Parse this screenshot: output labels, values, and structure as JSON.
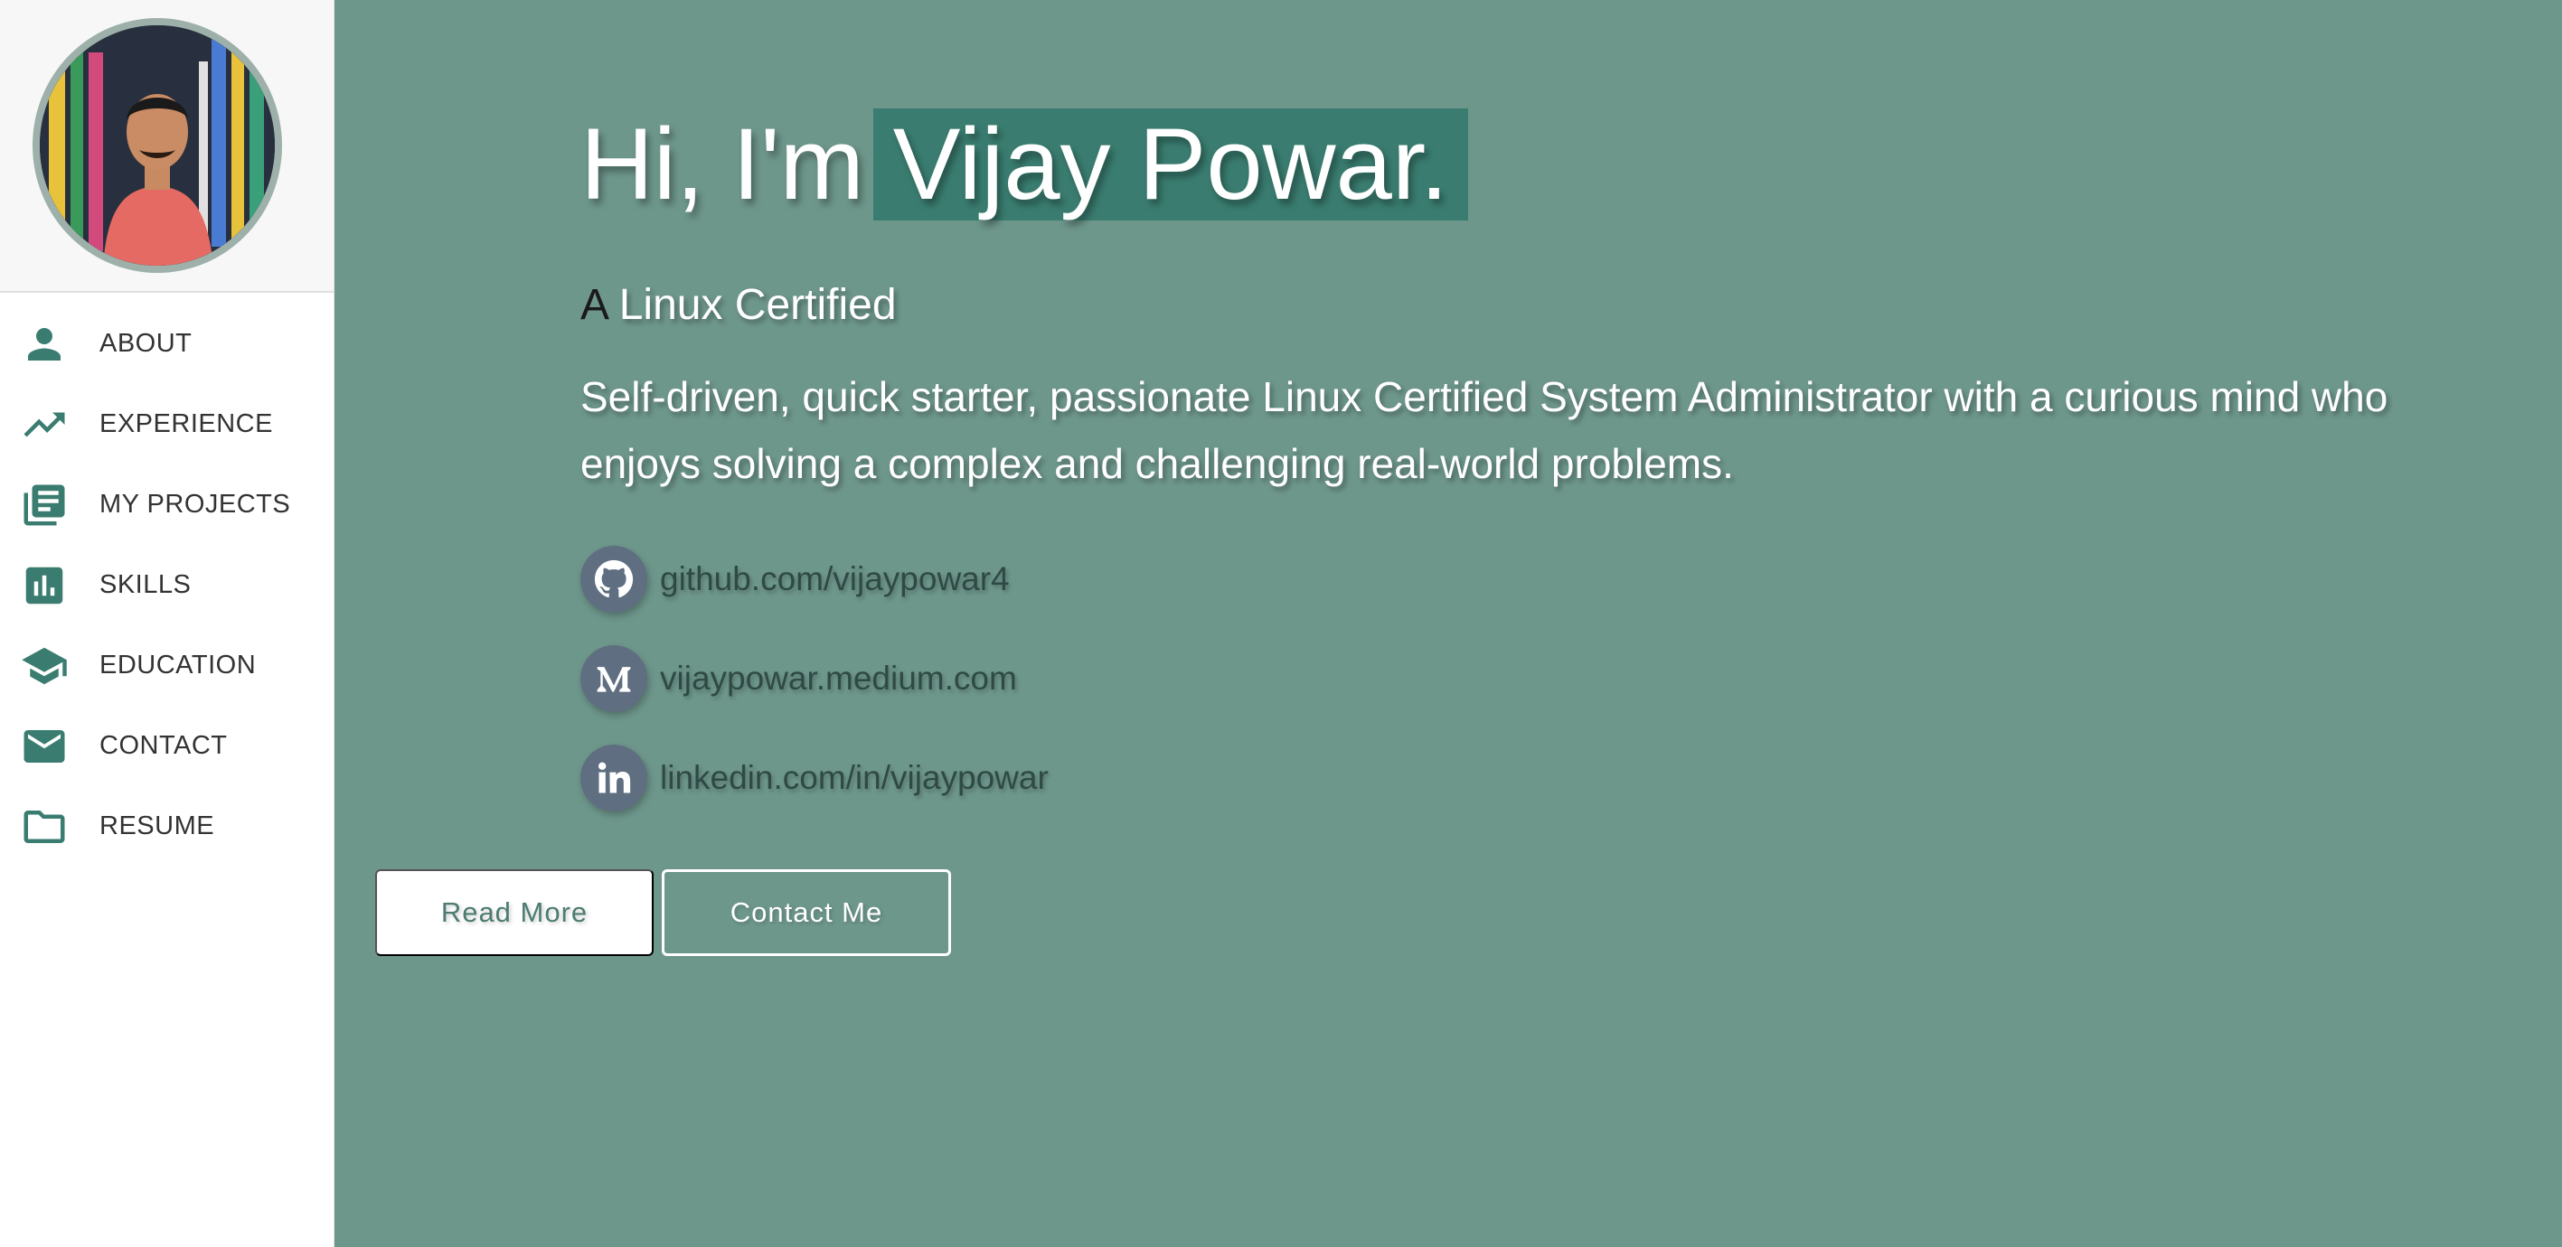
{
  "sidebar": {
    "profile": {
      "avatar_alt": "profile photo"
    },
    "items": [
      {
        "label": "ABOUT",
        "icon": "person-icon"
      },
      {
        "label": "EXPERIENCE",
        "icon": "trending-up-icon"
      },
      {
        "label": "MY PROJECTS",
        "icon": "library-books-icon"
      },
      {
        "label": "SKILLS",
        "icon": "bar-chart-icon"
      },
      {
        "label": "EDUCATION",
        "icon": "graduation-cap-icon"
      },
      {
        "label": "CONTACT",
        "icon": "mail-icon"
      },
      {
        "label": "RESUME",
        "icon": "folder-icon"
      }
    ]
  },
  "hero": {
    "greeting_prefix": "Hi, I'm",
    "name": "Vijay Powar.",
    "role_first_letter": "A",
    "role_rest": " Linux Certified",
    "bio": "Self-driven, quick starter, passionate Linux Certified System Administrator with a curious mind who enjoys solving a complex and challenging real-world problems.",
    "links": [
      {
        "text": "github.com/vijaypowar4",
        "icon": "github-icon"
      },
      {
        "text": "vijaypowar.medium.com",
        "icon": "medium-icon"
      },
      {
        "text": "linkedin.com/in/vijaypowar",
        "icon": "linkedin-icon"
      }
    ],
    "buttons": {
      "read_more": "Read More",
      "contact_me": "Contact Me"
    }
  },
  "colors": {
    "accent": "#3a7d70",
    "main_bg": "#6e978c",
    "link_icon_bg": "#5f6e80"
  }
}
